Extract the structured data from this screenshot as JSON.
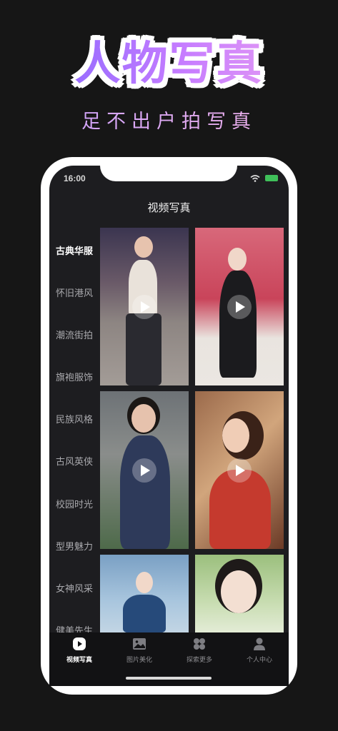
{
  "hero": {
    "title": "人物写真",
    "subtitle": "足不出户拍写真"
  },
  "status": {
    "time": "16:00"
  },
  "nav": {
    "title": "视频写真"
  },
  "sidebar": {
    "items": [
      {
        "label": "古典华服",
        "active": true
      },
      {
        "label": "怀旧港风"
      },
      {
        "label": "潮流街拍"
      },
      {
        "label": "旗袍服饰"
      },
      {
        "label": "民族风格"
      },
      {
        "label": "古风英侠"
      },
      {
        "label": "校园时光"
      },
      {
        "label": "型男魅力"
      },
      {
        "label": "女神风采"
      },
      {
        "label": "健美先生"
      }
    ]
  },
  "tabs": [
    {
      "label": "视频写真",
      "icon": "play-circle-icon",
      "active": true
    },
    {
      "label": "图片美化",
      "icon": "image-icon"
    },
    {
      "label": "探索更多",
      "icon": "grid-icon"
    },
    {
      "label": "个人中心",
      "icon": "person-icon"
    }
  ],
  "colors": {
    "background": "#161616",
    "screen": "#1d1d20",
    "accent_start": "#7d63ff",
    "accent_end": "#f0a7ee"
  }
}
